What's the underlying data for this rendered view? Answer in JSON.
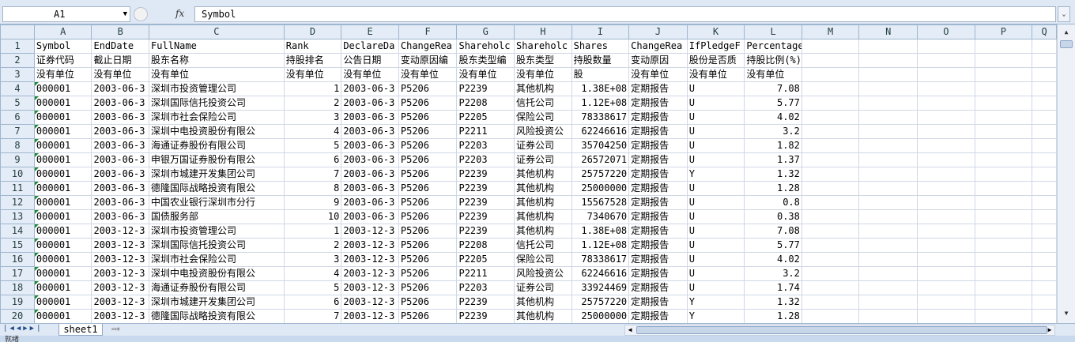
{
  "formula_bar": {
    "cell_ref": "A1",
    "fx_label": "fx",
    "content": "Symbol"
  },
  "columns": [
    "A",
    "B",
    "C",
    "D",
    "E",
    "F",
    "G",
    "H",
    "I",
    "J",
    "K",
    "L",
    "M",
    "N",
    "O",
    "P",
    "Q"
  ],
  "rows": [
    {
      "n": "1",
      "cells": [
        "Symbol",
        "EndDate",
        "FullName",
        "Rank",
        "DeclareDa",
        "ChangeRea",
        "Shareholc",
        "Shareholc",
        "Shares",
        "ChangeRea",
        "IfPledgeF",
        "PercentageHolding",
        "",
        "",
        "",
        "",
        ""
      ]
    },
    {
      "n": "2",
      "cells": [
        "证券代码",
        "截止日期",
        "股东名称",
        "持股排名",
        "公告日期",
        "变动原因编",
        "股东类型编",
        "股东类型",
        "持股数量",
        "变动原因",
        "股份是否质",
        "持股比例(%)",
        "",
        "",
        "",
        "",
        ""
      ]
    },
    {
      "n": "3",
      "cells": [
        "没有单位",
        "没有单位",
        "没有单位",
        "没有单位",
        "没有单位",
        "没有单位",
        "没有单位",
        "没有单位",
        "股",
        "没有单位",
        "没有单位",
        "没有单位",
        "",
        "",
        "",
        "",
        ""
      ]
    },
    {
      "n": "4",
      "cells": [
        "000001",
        "2003-06-3",
        "深圳市投资管理公司",
        "1",
        "2003-06-3",
        "P5206",
        "P2239",
        "其他机构",
        "1.38E+08",
        "定期报告",
        "U",
        "7.08",
        "",
        "",
        "",
        "",
        ""
      ]
    },
    {
      "n": "5",
      "cells": [
        "000001",
        "2003-06-3",
        "深圳国际信托投资公司",
        "2",
        "2003-06-3",
        "P5206",
        "P2208",
        "信托公司",
        "1.12E+08",
        "定期报告",
        "U",
        "5.77",
        "",
        "",
        "",
        "",
        ""
      ]
    },
    {
      "n": "6",
      "cells": [
        "000001",
        "2003-06-3",
        "深圳市社会保险公司",
        "3",
        "2003-06-3",
        "P5206",
        "P2205",
        "保险公司",
        "78338617",
        "定期报告",
        "U",
        "4.02",
        "",
        "",
        "",
        "",
        ""
      ]
    },
    {
      "n": "7",
      "cells": [
        "000001",
        "2003-06-3",
        "深圳中电投资股份有限公",
        "4",
        "2003-06-3",
        "P5206",
        "P2211",
        "风险投资公",
        "62246616",
        "定期报告",
        "U",
        "3.2",
        "",
        "",
        "",
        "",
        ""
      ]
    },
    {
      "n": "8",
      "cells": [
        "000001",
        "2003-06-3",
        "海通证券股份有限公司",
        "5",
        "2003-06-3",
        "P5206",
        "P2203",
        "证券公司",
        "35704250",
        "定期报告",
        "U",
        "1.82",
        "",
        "",
        "",
        "",
        ""
      ]
    },
    {
      "n": "9",
      "cells": [
        "000001",
        "2003-06-3",
        "申银万国证券股份有限公",
        "6",
        "2003-06-3",
        "P5206",
        "P2203",
        "证券公司",
        "26572071",
        "定期报告",
        "U",
        "1.37",
        "",
        "",
        "",
        "",
        ""
      ]
    },
    {
      "n": "10",
      "cells": [
        "000001",
        "2003-06-3",
        "深圳市城建开发集团公司",
        "7",
        "2003-06-3",
        "P5206",
        "P2239",
        "其他机构",
        "25757220",
        "定期报告",
        "Y",
        "1.32",
        "",
        "",
        "",
        "",
        ""
      ]
    },
    {
      "n": "11",
      "cells": [
        "000001",
        "2003-06-3",
        "德隆国际战略投资有限公",
        "8",
        "2003-06-3",
        "P5206",
        "P2239",
        "其他机构",
        "25000000",
        "定期报告",
        "U",
        "1.28",
        "",
        "",
        "",
        "",
        ""
      ]
    },
    {
      "n": "12",
      "cells": [
        "000001",
        "2003-06-3",
        "中国农业银行深圳市分行",
        "9",
        "2003-06-3",
        "P5206",
        "P2239",
        "其他机构",
        "15567528",
        "定期报告",
        "U",
        "0.8",
        "",
        "",
        "",
        "",
        ""
      ]
    },
    {
      "n": "13",
      "cells": [
        "000001",
        "2003-06-3",
        "国债服务部",
        "10",
        "2003-06-3",
        "P5206",
        "P2239",
        "其他机构",
        "7340670",
        "定期报告",
        "U",
        "0.38",
        "",
        "",
        "",
        "",
        ""
      ]
    },
    {
      "n": "14",
      "cells": [
        "000001",
        "2003-12-3",
        "深圳市投资管理公司",
        "1",
        "2003-12-3",
        "P5206",
        "P2239",
        "其他机构",
        "1.38E+08",
        "定期报告",
        "U",
        "7.08",
        "",
        "",
        "",
        "",
        ""
      ]
    },
    {
      "n": "15",
      "cells": [
        "000001",
        "2003-12-3",
        "深圳国际信托投资公司",
        "2",
        "2003-12-3",
        "P5206",
        "P2208",
        "信托公司",
        "1.12E+08",
        "定期报告",
        "U",
        "5.77",
        "",
        "",
        "",
        "",
        ""
      ]
    },
    {
      "n": "16",
      "cells": [
        "000001",
        "2003-12-3",
        "深圳市社会保险公司",
        "3",
        "2003-12-3",
        "P5206",
        "P2205",
        "保险公司",
        "78338617",
        "定期报告",
        "U",
        "4.02",
        "",
        "",
        "",
        "",
        ""
      ]
    },
    {
      "n": "17",
      "cells": [
        "000001",
        "2003-12-3",
        "深圳中电投资股份有限公",
        "4",
        "2003-12-3",
        "P5206",
        "P2211",
        "风险投资公",
        "62246616",
        "定期报告",
        "U",
        "3.2",
        "",
        "",
        "",
        "",
        ""
      ]
    },
    {
      "n": "18",
      "cells": [
        "000001",
        "2003-12-3",
        "海通证券股份有限公司",
        "5",
        "2003-12-3",
        "P5206",
        "P2203",
        "证券公司",
        "33924469",
        "定期报告",
        "U",
        "1.74",
        "",
        "",
        "",
        "",
        ""
      ]
    },
    {
      "n": "19",
      "cells": [
        "000001",
        "2003-12-3",
        "深圳市城建开发集团公司",
        "6",
        "2003-12-3",
        "P5206",
        "P2239",
        "其他机构",
        "25757220",
        "定期报告",
        "Y",
        "1.32",
        "",
        "",
        "",
        "",
        ""
      ]
    },
    {
      "n": "20",
      "cells": [
        "000001",
        "2003-12-3",
        "德隆国际战略投资有限公",
        "7",
        "2003-12-3",
        "P5206",
        "P2239",
        "其他机构",
        "25000000",
        "定期报告",
        "Y",
        "1.28",
        "",
        "",
        "",
        "",
        ""
      ]
    }
  ],
  "sheet_tabs": [
    "sheet1"
  ],
  "status": {
    "label": "就绪"
  },
  "colors": {
    "header_bg": "#e4ecf7",
    "grid_line": "#d0d7e5",
    "number_marker": "#1e8a2e"
  }
}
